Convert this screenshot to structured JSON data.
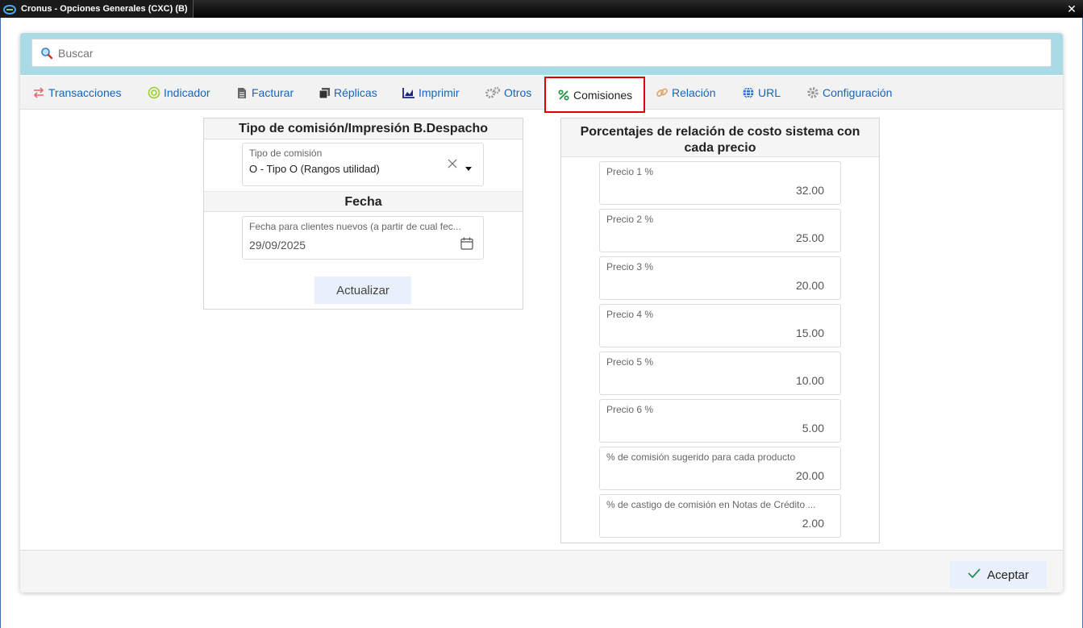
{
  "window": {
    "title": "Cronus - Opciones Generales (CXC) (B)",
    "close_glyph": "✕"
  },
  "search": {
    "placeholder": "Buscar",
    "value": ""
  },
  "tabs": [
    {
      "label": "Transacciones",
      "icon": "arrows-exchange-icon"
    },
    {
      "label": "Indicador",
      "icon": "target-icon"
    },
    {
      "label": "Facturar",
      "icon": "document-icon"
    },
    {
      "label": "Réplicas",
      "icon": "copy-icon"
    },
    {
      "label": "Imprimir",
      "icon": "chart-icon"
    },
    {
      "label": "Otros",
      "icon": "gears-icon"
    },
    {
      "label": "Comisiones",
      "icon": "percent-icon",
      "active": true
    },
    {
      "label": "Relación",
      "icon": "link-icon"
    },
    {
      "label": "URL",
      "icon": "globe-icon"
    },
    {
      "label": "Configuración",
      "icon": "gear-icon"
    }
  ],
  "left_panel": {
    "title": "Tipo de comisión/Impresión B.Despacho",
    "commission_type": {
      "label": "Tipo de comisión",
      "value": "O - Tipo O (Rangos utilidad)"
    },
    "date_section_title": "Fecha",
    "date_field": {
      "label": "Fecha para clientes nuevos (a partir de cual fec...",
      "value": "29/09/2025"
    },
    "update_button": "Actualizar"
  },
  "right_panel": {
    "title_line1": "Porcentajes de relación de costo sistema con",
    "title_line2": "cada precio",
    "fields": [
      {
        "label": "Precio 1 %",
        "value": "32.00"
      },
      {
        "label": "Precio 2 %",
        "value": "25.00"
      },
      {
        "label": "Precio 3 %",
        "value": "20.00"
      },
      {
        "label": "Precio 4 %",
        "value": "15.00"
      },
      {
        "label": "Precio 5 %",
        "value": "10.00"
      },
      {
        "label": "Precio 6 %",
        "value": "5.00"
      },
      {
        "label": "% de comisión sugerido para cada producto",
        "value": "20.00"
      },
      {
        "label": "% de castigo de comisión en Notas de Crédito ...",
        "value": "2.00"
      }
    ]
  },
  "footer": {
    "accept_button": "Aceptar"
  },
  "colors": {
    "accent": "#1565c0",
    "search_band": "#a9dbe6",
    "active_tab_border": "#e00000"
  }
}
